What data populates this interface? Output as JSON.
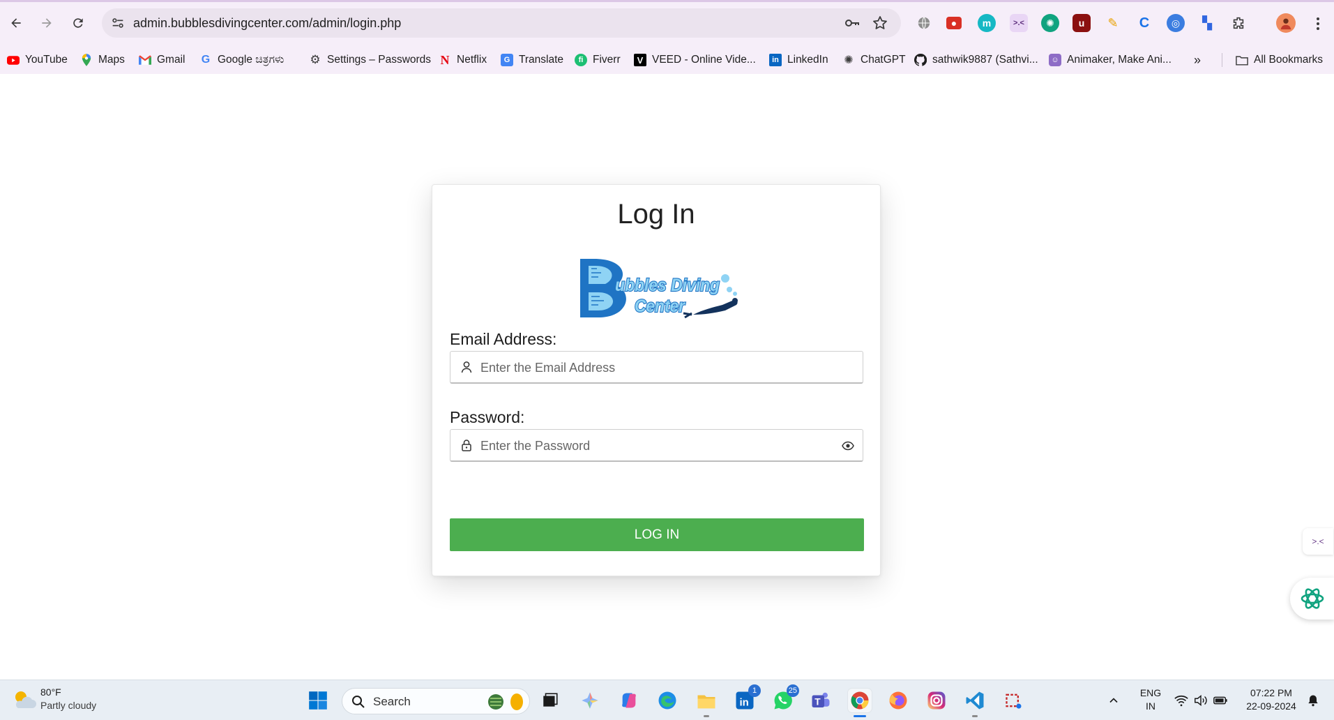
{
  "browser": {
    "url": "admin.bubblesdivingcenter.com/admin/login.php",
    "bookmarks": [
      {
        "label": "YouTube",
        "icon": "youtube-icon"
      },
      {
        "label": "Maps",
        "icon": "maps-icon"
      },
      {
        "label": "Gmail",
        "icon": "gmail-icon"
      },
      {
        "label": "Google ಚಿತ್ರಗಳು",
        "icon": "google-icon"
      },
      {
        "label": "Settings – Passwords",
        "icon": "gear-icon"
      },
      {
        "label": "Netflix",
        "icon": "netflix-icon"
      },
      {
        "label": "Translate",
        "icon": "translate-icon"
      },
      {
        "label": "Fiverr",
        "icon": "fiverr-icon"
      },
      {
        "label": "VEED - Online Vide...",
        "icon": "veed-icon"
      },
      {
        "label": "LinkedIn",
        "icon": "linkedin-icon"
      },
      {
        "label": "ChatGPT",
        "icon": "chatgpt-icon"
      },
      {
        "label": "sathwik9887 (Sathvi...",
        "icon": "github-icon"
      },
      {
        "label": "Animaker, Make Ani...",
        "icon": "animaker-icon"
      }
    ],
    "all_bookmarks": "All Bookmarks"
  },
  "login": {
    "title": "Log In",
    "logo_text_1": "ubbles Diving",
    "logo_text_2": "Center",
    "email_label": "Email Address:",
    "email_placeholder": "Enter the Email Address",
    "password_label": "Password:",
    "password_placeholder": "Enter the Password",
    "submit_label": "LOG IN"
  },
  "colors": {
    "submit_bg": "#4cae4f",
    "chrome_bg": "#f6eef9",
    "logo_blue": "#1f74c4"
  },
  "taskbar": {
    "weather_temp": "80°F",
    "weather_desc": "Partly cloudy",
    "search_label": "Search",
    "linkedin_badge": "1",
    "whatsapp_badge": "25",
    "lang_1": "ENG",
    "lang_2": "IN",
    "time": "07:22 PM",
    "date": "22-09-2024"
  }
}
